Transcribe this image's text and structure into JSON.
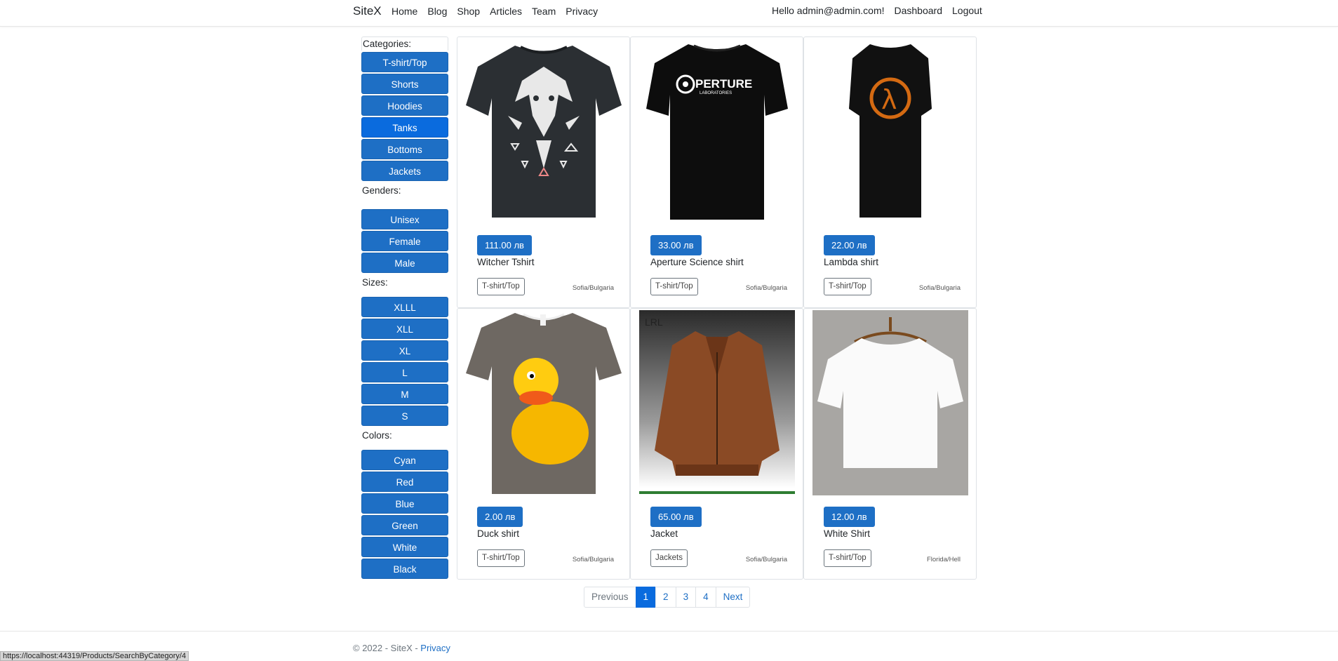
{
  "nav": {
    "brand": "SiteX",
    "links": [
      "Home",
      "Blog",
      "Shop",
      "Articles",
      "Team",
      "Privacy"
    ],
    "greeting": "Hello admin@admin.com!",
    "dashboard": "Dashboard",
    "logout": "Logout"
  },
  "sidebar": {
    "categories_label": "Categories:",
    "categories": [
      "T-shirt/Top",
      "Shorts",
      "Hoodies",
      "Tanks",
      "Bottoms",
      "Jackets"
    ],
    "active_category": "Tanks",
    "genders_label": "Genders:",
    "genders": [
      "Unisex",
      "Female",
      "Male"
    ],
    "sizes_label": "Sizes:",
    "sizes": [
      "XLLL",
      "XLL",
      "XL",
      "L",
      "M",
      "S"
    ],
    "colors_label": "Colors:",
    "colors": [
      "Cyan",
      "Red",
      "Blue",
      "Green",
      "White",
      "Black"
    ]
  },
  "products": [
    {
      "price": "111.00 лв",
      "name": "Witcher Tshirt",
      "category": "T-shirt/Top",
      "location": "Sofia/Bulgaria",
      "image": "witcher-tshirt"
    },
    {
      "price": "33.00 лв",
      "name": "Aperture Science shirt",
      "category": "T-shirt/Top",
      "location": "Sofia/Bulgaria",
      "image": "aperture-shirt"
    },
    {
      "price": "22.00 лв",
      "name": "Lambda shirt",
      "category": "T-shirt/Top",
      "location": "Sofia/Bulgaria",
      "image": "lambda-shirt"
    },
    {
      "price": "2.00 лв",
      "name": "Duck shirt",
      "category": "T-shirt/Top",
      "location": "Sofia/Bulgaria",
      "image": "duck-shirt"
    },
    {
      "price": "65.00 лв",
      "name": "Jacket",
      "category": "Jackets",
      "location": "Sofia/Bulgaria",
      "image": "leather-jacket"
    },
    {
      "price": "12.00 лв",
      "name": "White Shirt",
      "category": "T-shirt/Top",
      "location": "Florida/Hell",
      "image": "white-shirt"
    }
  ],
  "pagination": {
    "previous": "Previous",
    "pages": [
      "1",
      "2",
      "3",
      "4"
    ],
    "active": "1",
    "next": "Next"
  },
  "footer": {
    "text": "© 2022 - SiteX - ",
    "privacy": "Privacy"
  },
  "status_url": "https://localhost:44319/Products/SearchByCategory/4",
  "colors": {
    "primary": "#1e6fc5",
    "active": "#0a6bde"
  }
}
